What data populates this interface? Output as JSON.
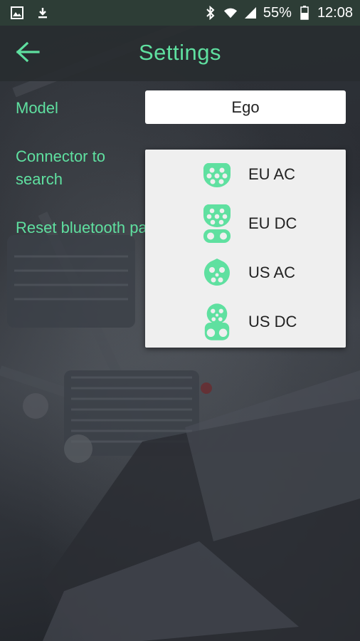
{
  "status_bar": {
    "battery": "55%",
    "time": "12:08",
    "icons": [
      "image-icon",
      "download-icon",
      "bluetooth-icon",
      "wifi-icon",
      "signal-icon",
      "battery-icon"
    ]
  },
  "app_bar": {
    "title": "Settings",
    "back_icon": "back-arrow-icon"
  },
  "settings": {
    "model_label": "Model",
    "model_value": "Ego",
    "connector_label_line1": "Connector to",
    "connector_label_line2": "search",
    "reset_label": "Reset bluetooth pai"
  },
  "connector_options": [
    {
      "label": "EU AC",
      "icon": "eu-ac-connector-icon"
    },
    {
      "label": "EU DC",
      "icon": "eu-dc-connector-icon"
    },
    {
      "label": "US AC",
      "icon": "us-ac-connector-icon"
    },
    {
      "label": "US DC",
      "icon": "us-dc-connector-icon"
    }
  ],
  "colors": {
    "accent": "#5fe0a0",
    "status_bar": "#2d3d36",
    "dropdown_bg": "#efefef"
  }
}
